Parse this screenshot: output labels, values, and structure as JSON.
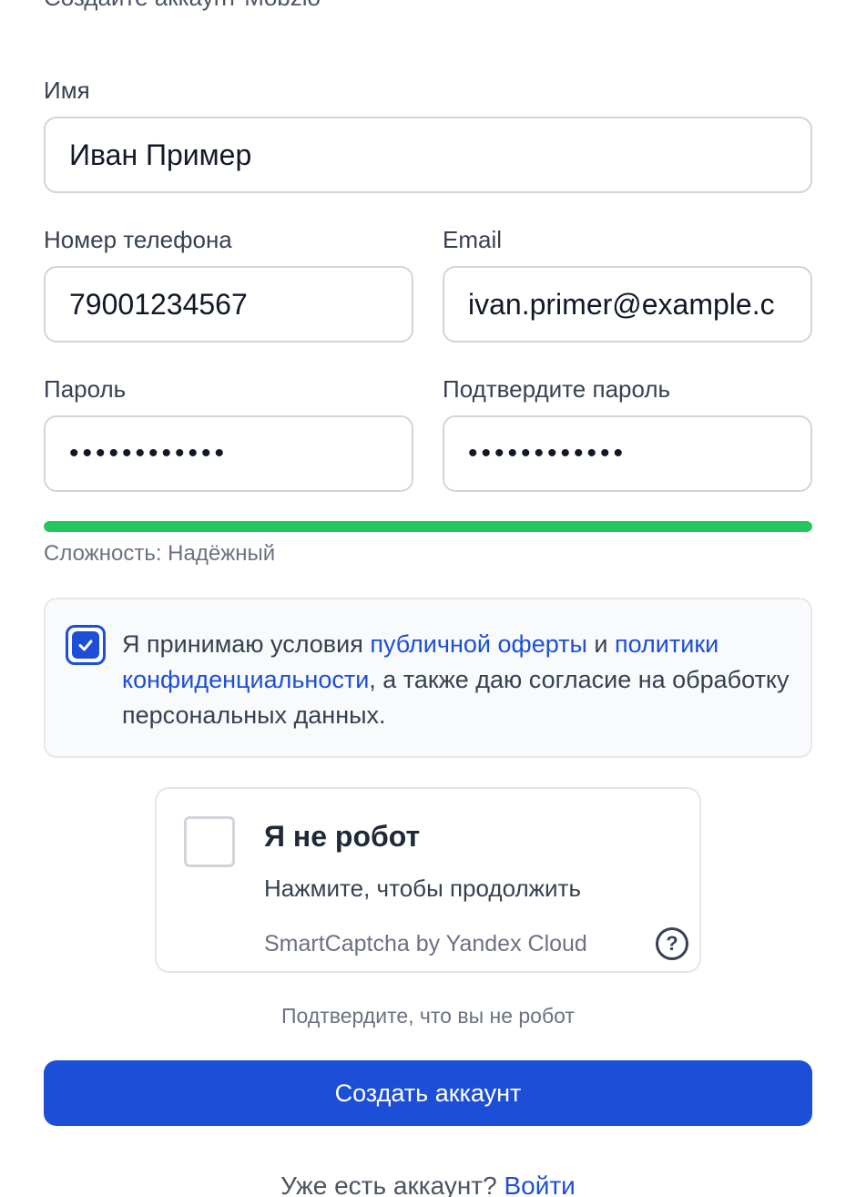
{
  "header": {
    "subtitle": "Создайте аккаунт Mobzio"
  },
  "form": {
    "name": {
      "label": "Имя",
      "value": "Иван Пример"
    },
    "phone": {
      "label": "Номер телефона",
      "value": "79001234567"
    },
    "email": {
      "label": "Email",
      "value": "ivan.primer@example.c"
    },
    "password": {
      "label": "Пароль",
      "value": "••••••••••••"
    },
    "confirm_password": {
      "label": "Подтвердите пароль",
      "value": "••••••••••••"
    },
    "strength": {
      "text": "Сложность: Надёжный",
      "level": 1.0,
      "color": "#22c55e"
    }
  },
  "consent": {
    "checked": true,
    "text_1": "Я принимаю условия ",
    "link_offer": "публичной оферты",
    "text_2": " и ",
    "link_privacy": "политики конфиденциальности",
    "text_3": ", а также даю согласие на обработку персональных данных."
  },
  "captcha": {
    "title": "Я не робот",
    "subtitle": "Нажмите, чтобы продолжить",
    "brand": "SmartCaptcha by Yandex Cloud",
    "help_icon": "?",
    "note": "Подтвердите, что вы не робот"
  },
  "submit": {
    "label": "Создать аккаунт",
    "color": "#1d4ed8"
  },
  "footer": {
    "text": "Уже есть аккаунт? ",
    "link": "Войти"
  }
}
